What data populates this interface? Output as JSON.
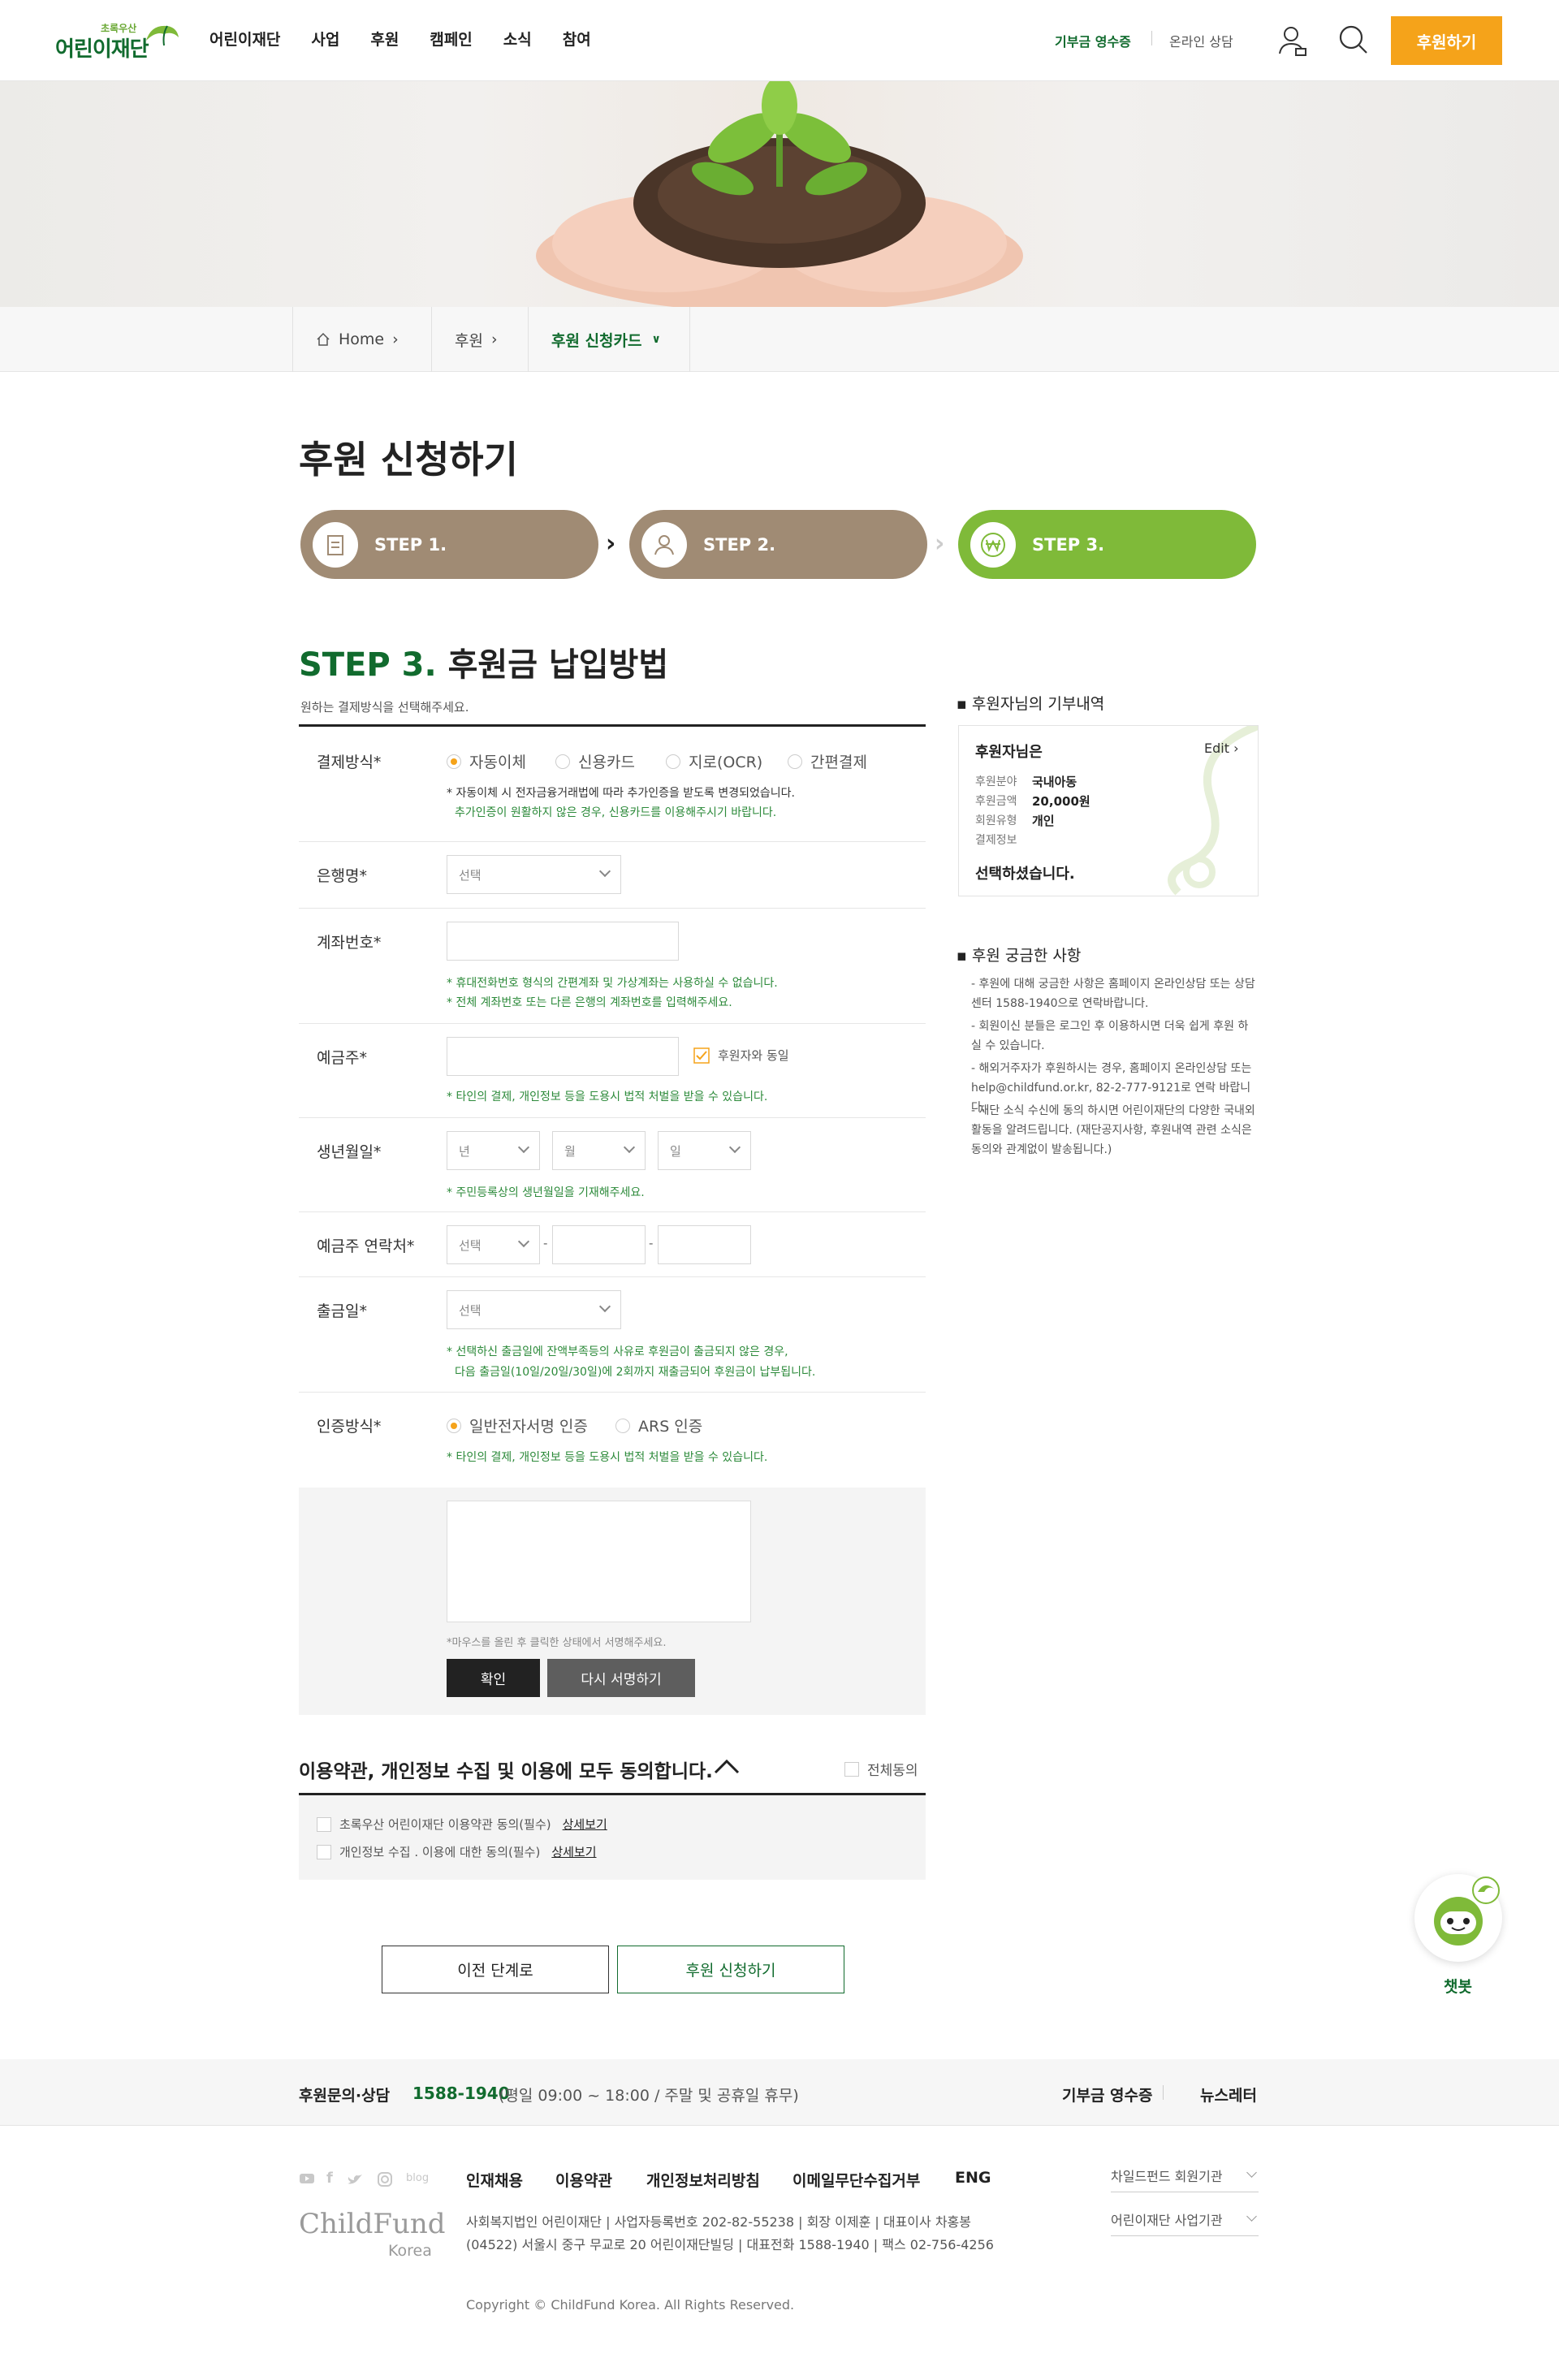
{
  "header": {
    "logo_sub": "초록우산",
    "logo_main": "어린이재단",
    "nav": [
      "어린이재단",
      "사업",
      "후원",
      "캠페인",
      "소식",
      "참여"
    ],
    "receipt": "기부금 영수증",
    "consult": "온라인 상담",
    "donate_button": "후원하기",
    "accent": "#f5a31a",
    "brand": "#116b2e"
  },
  "breadcrumb": {
    "home": "Home",
    "level1": "후원",
    "level2": "후원 신청카드"
  },
  "page_title": "후원 신청하기",
  "steps": [
    {
      "label": "STEP 1.",
      "color": "#a08b74"
    },
    {
      "label": "STEP 2.",
      "color": "#a08b74"
    },
    {
      "label": "STEP 3.",
      "color": "#7fba39"
    }
  ],
  "section": {
    "step": "STEP 3.",
    "title": "후원금 납입방법",
    "desc": "원하는 결제방식을 선택해주세요."
  },
  "form": {
    "payment": {
      "label": "결제방식*",
      "options": [
        "자동이체",
        "신용카드",
        "지로(OCR)",
        "간편결제"
      ],
      "hint1": "* 자동이체 시 전자금융거래법에 따라 추가인증을 받도록 변경되었습니다.",
      "hint2": "추가인증이 원활하지 않은 경우, 신용카드를 이용해주시기 바랍니다."
    },
    "bank": {
      "label": "은행명*",
      "select": "선택"
    },
    "account": {
      "label": "계좌번호*",
      "hint1": "* 휴대전화번호 형식의 간편계좌 및 가상계좌는 사용하실 수 없습니다.",
      "hint2": "* 전체 계좌번호 또는 다른 은행의 계좌번호를 입력해주세요."
    },
    "holder": {
      "label": "예금주*",
      "same": "후원자와 동일",
      "hint": "* 타인의 결제, 개인정보 등을 도용시 법적 처벌을 받을 수 있습니다."
    },
    "birth": {
      "label": "생년월일*",
      "year": "년",
      "month": "월",
      "day": "일",
      "hint": "* 주민등록상의 생년월일을 기재해주세요."
    },
    "phone": {
      "label": "예금주 연락처*",
      "select": "선택",
      "dash": "-"
    },
    "withdraw": {
      "label": "출금일*",
      "select": "선택",
      "hint1": "* 선택하신 출금일에 잔액부족등의 사유로 후원금이 출금되지 않은 경우,",
      "hint2": "다음 출금일(10일/20일/30일)에 2회까지 재출금되어 후원금이 납부됩니다."
    },
    "auth": {
      "label": "인증방식*",
      "options": [
        "일반전자서명 인증",
        "ARS 인증"
      ],
      "hint": "* 타인의 결제, 개인정보 등을 도용시 법적 처벌을 받을 수 있습니다."
    },
    "sign": {
      "hint": "*마우스를 올린 후 클릭한 상태에서 서명해주세요.",
      "confirm": "확인",
      "retry": "다시 서명하기"
    }
  },
  "terms": {
    "title": "이용약관, 개인정보 수집 및 이용에 모두 동의합니다.",
    "all": "전체동의",
    "items": [
      {
        "text": "초록우산 어린이재단 이용약관 동의(필수)",
        "link": "상세보기"
      },
      {
        "text": "개인정보 수집 . 이용에 대한 동의(필수)",
        "link": "상세보기"
      }
    ]
  },
  "buttons": {
    "prev": "이전 단계로",
    "submit": "후원 신청하기"
  },
  "sidebar": {
    "history_title": "후원자님의 기부내역",
    "box": {
      "greet": "후원자님은",
      "edit": "Edit",
      "rows": [
        {
          "k": "후원분야",
          "v": "국내아동"
        },
        {
          "k": "후원금액",
          "v": "20,000원"
        },
        {
          "k": "회원유형",
          "v": "개인"
        },
        {
          "k": "결제정보",
          "v": ""
        }
      ],
      "closing": "선택하셨습니다."
    },
    "faq_title": "후원 궁금한 사항",
    "faq": [
      "- 후원에 대해 궁금한 사항은 홈페이지 온라인상담 또는 상담센터 1588-1940으로 연락바랍니다.",
      "- 회원이신 분들은 로그인 후 이용하시면 더욱 쉽게 후원 하실 수 있습니다.",
      "- 해외거주자가 후원하시는 경우, 홈페이지 온라인상담 또는 help@childfund.or.kr, 82-2-777-9121로 연락 바랍니다.",
      "- 재단 소식 수신에 동의 하시면 어린이재단의 다양한 국내외 활동을 알려드립니다. (재단공지사항, 후원내역 관련 소식은 동의와 관계없이 발송됩니다.)"
    ]
  },
  "chatbot": {
    "label": "챗봇"
  },
  "footer": {
    "inquiry_label": "후원문의·상담",
    "phone": "1588-1940",
    "hours": "(평일 09:00 ~ 18:00 / 주말 및 공휴일 휴무)",
    "receipt": "기부금 영수증",
    "newsletter": "뉴스레터",
    "links": [
      "인재채용",
      "이용약관",
      "개인정보처리방침",
      "이메일무단수집거부",
      "ENG"
    ],
    "blog": "blog",
    "logo_main": "ChildFund",
    "logo_sub": "Korea",
    "info1": "사회복지법인 어린이재단 | 사업자등록번호 202-82-55238 | 회장 이제훈 | 대표이사 차홍봉",
    "info2": "(04522) 서울시 중구 무교로 20 어린이재단빌딩 | 대표전화 1588-1940 | 팩스 02-756-4256",
    "copyright": "Copyright © ChildFund Korea. All Rights Reserved.",
    "select1": "차일드펀드 회원기관",
    "select2": "어린이재단 사업기관"
  }
}
